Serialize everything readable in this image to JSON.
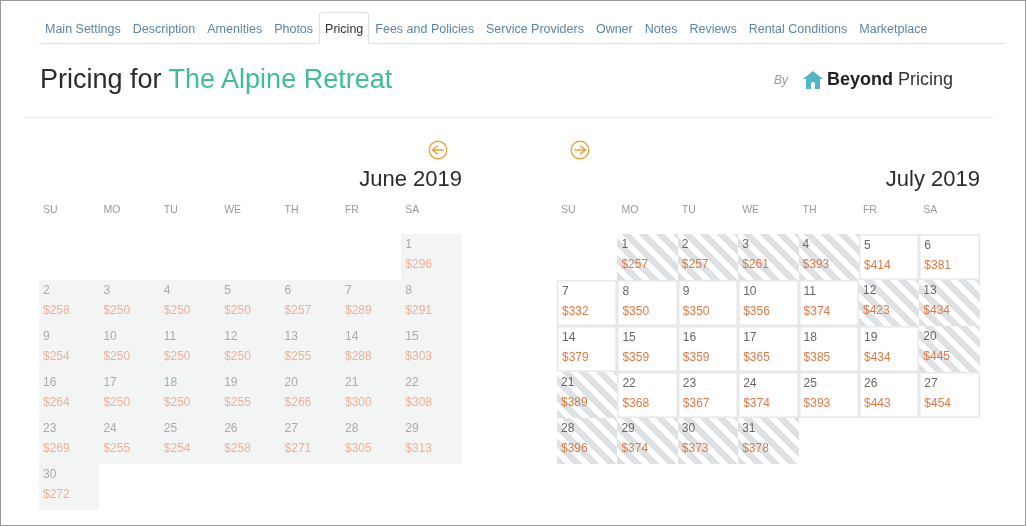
{
  "tabs": [
    {
      "label": "Main Settings",
      "selected": false
    },
    {
      "label": "Description",
      "selected": false
    },
    {
      "label": "Amenities",
      "selected": false
    },
    {
      "label": "Photos",
      "selected": false
    },
    {
      "label": "Pricing",
      "selected": true
    },
    {
      "label": "Fees and Policies",
      "selected": false
    },
    {
      "label": "Service Providers",
      "selected": false
    },
    {
      "label": "Owner",
      "selected": false
    },
    {
      "label": "Notes",
      "selected": false
    },
    {
      "label": "Reviews",
      "selected": false
    },
    {
      "label": "Rental Conditions",
      "selected": false
    },
    {
      "label": "Marketplace",
      "selected": false
    }
  ],
  "heading": {
    "prefix": "Pricing for",
    "property": "The Alpine Retreat"
  },
  "provider": {
    "by": "By",
    "name": "**Beyond** Pricing"
  },
  "months": [
    {
      "title": "June 2019",
      "prev_arrow": true,
      "weekdays": [
        "SU",
        "MO",
        "TU",
        "WE",
        "TH",
        "FR",
        "SA"
      ],
      "weeks": [
        [
          {
            "kind": "empty"
          },
          {
            "kind": "empty"
          },
          {
            "kind": "empty"
          },
          {
            "kind": "empty"
          },
          {
            "kind": "empty"
          },
          {
            "kind": "empty"
          },
          {
            "kind": "day",
            "day": "1",
            "price": "$296",
            "past": true
          }
        ],
        [
          {
            "kind": "day",
            "day": "2",
            "price": "$258",
            "past": true
          },
          {
            "kind": "day",
            "day": "3",
            "price": "$250",
            "past": true
          },
          {
            "kind": "day",
            "day": "4",
            "price": "$250",
            "past": true
          },
          {
            "kind": "day",
            "day": "5",
            "price": "$250",
            "past": true
          },
          {
            "kind": "day",
            "day": "6",
            "price": "$257",
            "past": true
          },
          {
            "kind": "day",
            "day": "7",
            "price": "$289",
            "past": true
          },
          {
            "kind": "day",
            "day": "8",
            "price": "$291",
            "past": true
          }
        ],
        [
          {
            "kind": "day",
            "day": "9",
            "price": "$254",
            "past": true
          },
          {
            "kind": "day",
            "day": "10",
            "price": "$250",
            "past": true
          },
          {
            "kind": "day",
            "day": "11",
            "price": "$250",
            "past": true
          },
          {
            "kind": "day",
            "day": "12",
            "price": "$250",
            "past": true
          },
          {
            "kind": "day",
            "day": "13",
            "price": "$255",
            "past": true
          },
          {
            "kind": "day",
            "day": "14",
            "price": "$288",
            "past": true
          },
          {
            "kind": "day",
            "day": "15",
            "price": "$303",
            "past": true
          }
        ],
        [
          {
            "kind": "day",
            "day": "16",
            "price": "$264",
            "past": true
          },
          {
            "kind": "day",
            "day": "17",
            "price": "$250",
            "past": true
          },
          {
            "kind": "day",
            "day": "18",
            "price": "$250",
            "past": true
          },
          {
            "kind": "day",
            "day": "19",
            "price": "$255",
            "past": true
          },
          {
            "kind": "day",
            "day": "20",
            "price": "$266",
            "past": true
          },
          {
            "kind": "day",
            "day": "21",
            "price": "$300",
            "past": true
          },
          {
            "kind": "day",
            "day": "22",
            "price": "$308",
            "past": true
          }
        ],
        [
          {
            "kind": "day",
            "day": "23",
            "price": "$269",
            "past": true
          },
          {
            "kind": "day",
            "day": "24",
            "price": "$255",
            "past": true
          },
          {
            "kind": "day",
            "day": "25",
            "price": "$254",
            "past": true
          },
          {
            "kind": "day",
            "day": "26",
            "price": "$258",
            "past": true
          },
          {
            "kind": "day",
            "day": "27",
            "price": "$271",
            "past": true
          },
          {
            "kind": "day",
            "day": "28",
            "price": "$305",
            "past": true
          },
          {
            "kind": "day",
            "day": "29",
            "price": "$313",
            "past": true
          }
        ],
        [
          {
            "kind": "day",
            "day": "30",
            "price": "$272",
            "past": true
          }
        ]
      ]
    },
    {
      "title": "July 2019",
      "next_arrow": true,
      "weekdays": [
        "SU",
        "MO",
        "TU",
        "WE",
        "TH",
        "FR",
        "SA"
      ],
      "weeks": [
        [
          {
            "kind": "empty"
          },
          {
            "kind": "day",
            "day": "1",
            "price": "$257",
            "booked": true
          },
          {
            "kind": "day",
            "day": "2",
            "price": "$257",
            "booked": true
          },
          {
            "kind": "day",
            "day": "3",
            "price": "$261",
            "booked": true
          },
          {
            "kind": "day",
            "day": "4",
            "price": "$393",
            "booked": true
          },
          {
            "kind": "day",
            "day": "5",
            "price": "$414",
            "booked": false
          },
          {
            "kind": "day",
            "day": "6",
            "price": "$381",
            "booked": false
          }
        ],
        [
          {
            "kind": "day",
            "day": "7",
            "price": "$332",
            "booked": false
          },
          {
            "kind": "day",
            "day": "8",
            "price": "$350",
            "booked": false
          },
          {
            "kind": "day",
            "day": "9",
            "price": "$350",
            "booked": false
          },
          {
            "kind": "day",
            "day": "10",
            "price": "$356",
            "booked": false
          },
          {
            "kind": "day",
            "day": "11",
            "price": "$374",
            "booked": false
          },
          {
            "kind": "day",
            "day": "12",
            "price": "$423",
            "booked": true
          },
          {
            "kind": "day",
            "day": "13",
            "price": "$434",
            "booked": true
          }
        ],
        [
          {
            "kind": "day",
            "day": "14",
            "price": "$379",
            "booked": false
          },
          {
            "kind": "day",
            "day": "15",
            "price": "$359",
            "booked": false
          },
          {
            "kind": "day",
            "day": "16",
            "price": "$359",
            "booked": false
          },
          {
            "kind": "day",
            "day": "17",
            "price": "$365",
            "booked": false
          },
          {
            "kind": "day",
            "day": "18",
            "price": "$385",
            "booked": false
          },
          {
            "kind": "day",
            "day": "19",
            "price": "$434",
            "booked": false
          },
          {
            "kind": "day",
            "day": "20",
            "price": "$445",
            "booked": true
          }
        ],
        [
          {
            "kind": "day",
            "day": "21",
            "price": "$389",
            "booked": true
          },
          {
            "kind": "day",
            "day": "22",
            "price": "$368",
            "booked": false
          },
          {
            "kind": "day",
            "day": "23",
            "price": "$367",
            "booked": false
          },
          {
            "kind": "day",
            "day": "24",
            "price": "$374",
            "booked": false
          },
          {
            "kind": "day",
            "day": "25",
            "price": "$393",
            "booked": false
          },
          {
            "kind": "day",
            "day": "26",
            "price": "$443",
            "booked": false
          },
          {
            "kind": "day",
            "day": "27",
            "price": "$454",
            "booked": false
          }
        ],
        [
          {
            "kind": "day",
            "day": "28",
            "price": "$396",
            "booked": true
          },
          {
            "kind": "day",
            "day": "29",
            "price": "$374",
            "booked": true
          },
          {
            "kind": "day",
            "day": "30",
            "price": "$373",
            "booked": true
          },
          {
            "kind": "day",
            "day": "31",
            "price": "$378",
            "booked": true
          }
        ]
      ]
    }
  ]
}
